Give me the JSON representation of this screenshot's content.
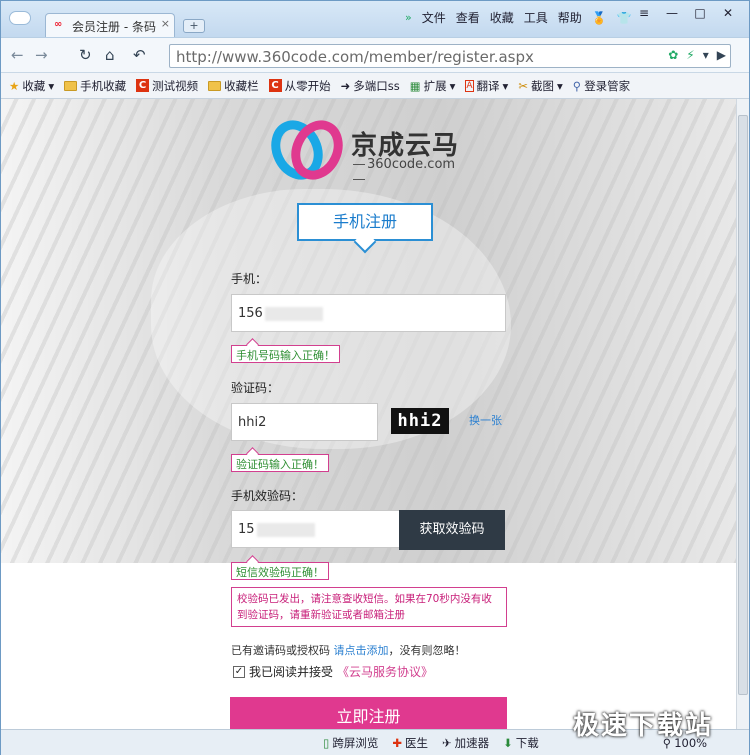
{
  "browser": {
    "tab_title": "会员注册 - 条码",
    "menus": [
      "文件",
      "查看",
      "收藏",
      "工具",
      "帮助"
    ],
    "url": "http://www.360code.com/member/register.aspx",
    "bookmarks": [
      "收藏",
      "手机收藏",
      "测试视频",
      "收藏栏",
      "从零开始",
      "多端口ss",
      "扩展",
      "翻译",
      "截图",
      "登录管家"
    ],
    "status_items": [
      "跨屏浏览",
      "医生",
      "加速器",
      "下载",
      "100%"
    ]
  },
  "page": {
    "logo_cn": "京成云马",
    "logo_en": "360code.com",
    "tab_label": "手机注册",
    "phone_label": "手机：",
    "phone_value": "156",
    "phone_tip": "手机号码输入正确！",
    "captcha_label": "验证码：",
    "captcha_value": "hhi2",
    "captcha_image_text": "hhi2",
    "captcha_refresh": "换一张",
    "captcha_tip": "验证码输入正确！",
    "sms_label": "手机效验码：",
    "sms_value": "15",
    "sms_button": "获取效验码",
    "sms_tip": "短信效验码正确！",
    "notice": "校验码已发出，请注意查收短信。如果在70秒内没有收到验证码，请重新验证或者邮箱注册",
    "invite_prefix": "已有邀请码或授权码",
    "invite_link": "请点击添加",
    "invite_suffix": "，没有则忽略！",
    "agree_text": "我已阅读并接受",
    "agree_link": "《云马服务协议》",
    "submit": "立即注册"
  },
  "watermark": "极速下载站",
  "colors": {
    "accent": "#e0398f",
    "blue": "#2b8fd4",
    "dark_button": "#2f3a45",
    "tip_green": "#2f8f33"
  }
}
